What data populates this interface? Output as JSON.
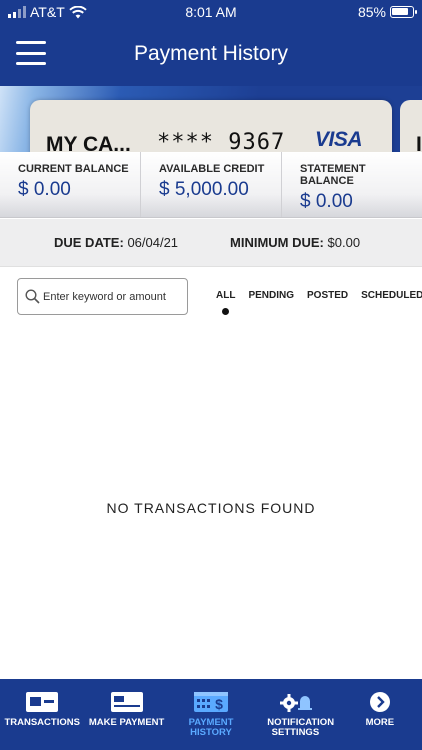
{
  "status_bar": {
    "carrier": "AT&T",
    "time": "8:01 AM",
    "battery": "85%"
  },
  "header": {
    "title": "Payment History"
  },
  "card": {
    "name": "MY CA...",
    "last4": "**** 9367",
    "brand": "VISA"
  },
  "balances": [
    {
      "label": "CURRENT BALANCE",
      "value": "$ 0.00"
    },
    {
      "label": "AVAILABLE CREDIT",
      "value": "$ 5,000.00"
    },
    {
      "label": "STATEMENT BALANCE",
      "value": "$ 0.00"
    }
  ],
  "due": {
    "date_label": "DUE DATE:",
    "date_value": "06/04/21",
    "min_label": "MINIMUM DUE:",
    "min_value": "$0.00"
  },
  "search": {
    "placeholder": "Enter keyword or amount"
  },
  "filters": [
    "ALL",
    "PENDING",
    "POSTED",
    "SCHEDULED"
  ],
  "empty_message": "NO TRANSACTIONS FOUND",
  "nav": [
    {
      "label": "TRANSACTIONS",
      "icon": "transactions-icon"
    },
    {
      "label": "MAKE PAYMENT",
      "icon": "card-icon"
    },
    {
      "label": "PAYMENT HISTORY",
      "icon": "calendar-dollar-icon"
    },
    {
      "label": "NOTIFICATION SETTINGS",
      "icon": "gear-bell-icon"
    },
    {
      "label": "MORE",
      "icon": "chevron-right-circle-icon"
    }
  ],
  "colors": {
    "brand_blue": "#1a3b8f",
    "active_tab": "#5aa9ff"
  }
}
